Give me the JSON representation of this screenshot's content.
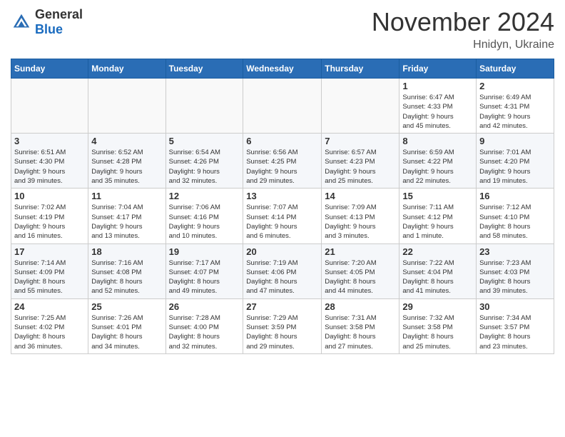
{
  "logo": {
    "general": "General",
    "blue": "Blue"
  },
  "title": "November 2024",
  "location": "Hnidyn, Ukraine",
  "weekdays": [
    "Sunday",
    "Monday",
    "Tuesday",
    "Wednesday",
    "Thursday",
    "Friday",
    "Saturday"
  ],
  "weeks": [
    [
      {
        "day": "",
        "info": ""
      },
      {
        "day": "",
        "info": ""
      },
      {
        "day": "",
        "info": ""
      },
      {
        "day": "",
        "info": ""
      },
      {
        "day": "",
        "info": ""
      },
      {
        "day": "1",
        "info": "Sunrise: 6:47 AM\nSunset: 4:33 PM\nDaylight: 9 hours\nand 45 minutes."
      },
      {
        "day": "2",
        "info": "Sunrise: 6:49 AM\nSunset: 4:31 PM\nDaylight: 9 hours\nand 42 minutes."
      }
    ],
    [
      {
        "day": "3",
        "info": "Sunrise: 6:51 AM\nSunset: 4:30 PM\nDaylight: 9 hours\nand 39 minutes."
      },
      {
        "day": "4",
        "info": "Sunrise: 6:52 AM\nSunset: 4:28 PM\nDaylight: 9 hours\nand 35 minutes."
      },
      {
        "day": "5",
        "info": "Sunrise: 6:54 AM\nSunset: 4:26 PM\nDaylight: 9 hours\nand 32 minutes."
      },
      {
        "day": "6",
        "info": "Sunrise: 6:56 AM\nSunset: 4:25 PM\nDaylight: 9 hours\nand 29 minutes."
      },
      {
        "day": "7",
        "info": "Sunrise: 6:57 AM\nSunset: 4:23 PM\nDaylight: 9 hours\nand 25 minutes."
      },
      {
        "day": "8",
        "info": "Sunrise: 6:59 AM\nSunset: 4:22 PM\nDaylight: 9 hours\nand 22 minutes."
      },
      {
        "day": "9",
        "info": "Sunrise: 7:01 AM\nSunset: 4:20 PM\nDaylight: 9 hours\nand 19 minutes."
      }
    ],
    [
      {
        "day": "10",
        "info": "Sunrise: 7:02 AM\nSunset: 4:19 PM\nDaylight: 9 hours\nand 16 minutes."
      },
      {
        "day": "11",
        "info": "Sunrise: 7:04 AM\nSunset: 4:17 PM\nDaylight: 9 hours\nand 13 minutes."
      },
      {
        "day": "12",
        "info": "Sunrise: 7:06 AM\nSunset: 4:16 PM\nDaylight: 9 hours\nand 10 minutes."
      },
      {
        "day": "13",
        "info": "Sunrise: 7:07 AM\nSunset: 4:14 PM\nDaylight: 9 hours\nand 6 minutes."
      },
      {
        "day": "14",
        "info": "Sunrise: 7:09 AM\nSunset: 4:13 PM\nDaylight: 9 hours\nand 3 minutes."
      },
      {
        "day": "15",
        "info": "Sunrise: 7:11 AM\nSunset: 4:12 PM\nDaylight: 9 hours\nand 1 minute."
      },
      {
        "day": "16",
        "info": "Sunrise: 7:12 AM\nSunset: 4:10 PM\nDaylight: 8 hours\nand 58 minutes."
      }
    ],
    [
      {
        "day": "17",
        "info": "Sunrise: 7:14 AM\nSunset: 4:09 PM\nDaylight: 8 hours\nand 55 minutes."
      },
      {
        "day": "18",
        "info": "Sunrise: 7:16 AM\nSunset: 4:08 PM\nDaylight: 8 hours\nand 52 minutes."
      },
      {
        "day": "19",
        "info": "Sunrise: 7:17 AM\nSunset: 4:07 PM\nDaylight: 8 hours\nand 49 minutes."
      },
      {
        "day": "20",
        "info": "Sunrise: 7:19 AM\nSunset: 4:06 PM\nDaylight: 8 hours\nand 47 minutes."
      },
      {
        "day": "21",
        "info": "Sunrise: 7:20 AM\nSunset: 4:05 PM\nDaylight: 8 hours\nand 44 minutes."
      },
      {
        "day": "22",
        "info": "Sunrise: 7:22 AM\nSunset: 4:04 PM\nDaylight: 8 hours\nand 41 minutes."
      },
      {
        "day": "23",
        "info": "Sunrise: 7:23 AM\nSunset: 4:03 PM\nDaylight: 8 hours\nand 39 minutes."
      }
    ],
    [
      {
        "day": "24",
        "info": "Sunrise: 7:25 AM\nSunset: 4:02 PM\nDaylight: 8 hours\nand 36 minutes."
      },
      {
        "day": "25",
        "info": "Sunrise: 7:26 AM\nSunset: 4:01 PM\nDaylight: 8 hours\nand 34 minutes."
      },
      {
        "day": "26",
        "info": "Sunrise: 7:28 AM\nSunset: 4:00 PM\nDaylight: 8 hours\nand 32 minutes."
      },
      {
        "day": "27",
        "info": "Sunrise: 7:29 AM\nSunset: 3:59 PM\nDaylight: 8 hours\nand 29 minutes."
      },
      {
        "day": "28",
        "info": "Sunrise: 7:31 AM\nSunset: 3:58 PM\nDaylight: 8 hours\nand 27 minutes."
      },
      {
        "day": "29",
        "info": "Sunrise: 7:32 AM\nSunset: 3:58 PM\nDaylight: 8 hours\nand 25 minutes."
      },
      {
        "day": "30",
        "info": "Sunrise: 7:34 AM\nSunset: 3:57 PM\nDaylight: 8 hours\nand 23 minutes."
      }
    ]
  ]
}
